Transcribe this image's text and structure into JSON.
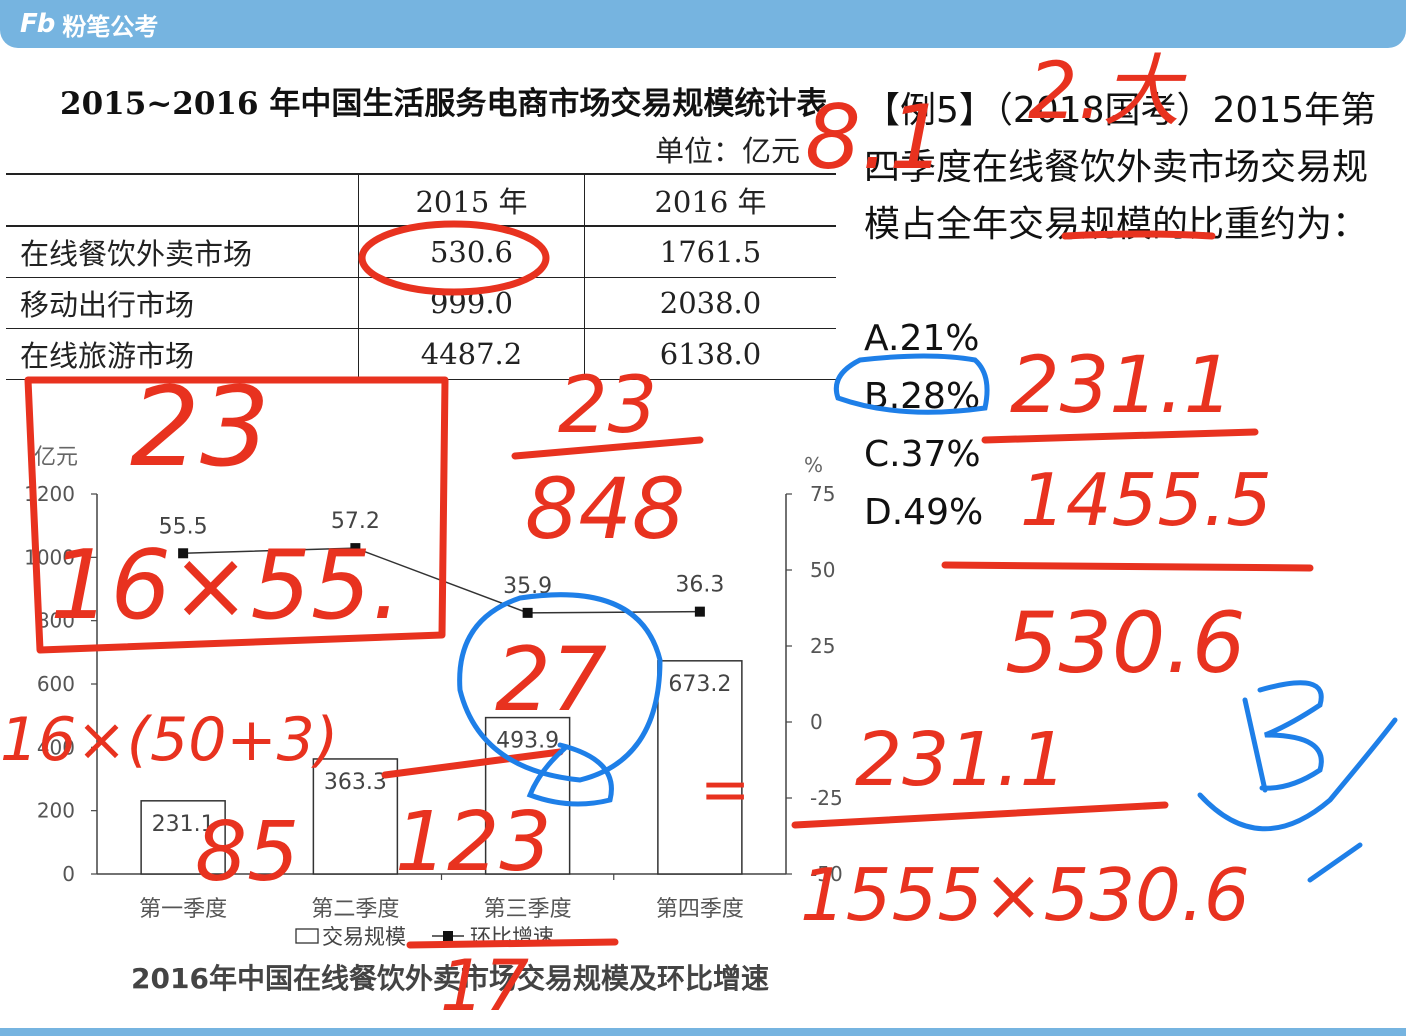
{
  "header": {
    "logo_mark": "Fb",
    "logo_text": "粉笔公考"
  },
  "table": {
    "title": "2015~2016 年中国生活服务电商市场交易规模统计表",
    "unit": "单位：亿元",
    "columns": [
      "",
      "2015 年",
      "2016 年"
    ],
    "rows": [
      [
        "在线餐饮外卖市场",
        "530.6",
        "1761.5"
      ],
      [
        "移动出行市场",
        "999.0",
        "2038.0"
      ],
      [
        "在线旅游市场",
        "4487.2",
        "6138.0"
      ]
    ]
  },
  "question": {
    "text": "【例5】（2018国考）2015年第四季度在线餐饮外卖市场交易规模占全年交易规模的比重约为：",
    "options": [
      "A.21%",
      "B.28%",
      "C.37%",
      "D.49%"
    ]
  },
  "chart_data": {
    "type": "bar",
    "title": "2016年中国在线餐饮外卖市场交易规模及环比增速",
    "categories": [
      "第一季度",
      "第二季度",
      "第三季度",
      "第四季度"
    ],
    "y_left_label": "亿元",
    "y_right_label": "%",
    "y_left_ticks": [
      "0",
      "200",
      "400",
      "600",
      "800",
      "1000",
      "1200"
    ],
    "y_right_ticks": [
      "-50",
      "-25",
      "0",
      "25",
      "50",
      "75"
    ],
    "ylim_left": [
      0,
      1200
    ],
    "ylim_right": [
      -50,
      75
    ],
    "series": [
      {
        "name": "交易规模",
        "kind": "bar",
        "values": [
          231.1,
          363.3,
          493.9,
          673.2
        ],
        "labels": [
          "231.1",
          "363.3",
          "493.9",
          "673.2"
        ]
      },
      {
        "name": "环比增速",
        "kind": "line",
        "values": [
          55.5,
          57.2,
          35.9,
          36.3
        ],
        "labels": [
          "55.5",
          "57.2",
          "35.9",
          "36.3"
        ]
      }
    ]
  },
  "annotations": {
    "red": [
      "8.1",
      "2.大",
      "23",
      "16×55.",
      "23",
      "848",
      "27",
      "231.1",
      "1455.5",
      "530.6",
      "231.1",
      "1555×530.6",
      "16×(50+3)",
      "85",
      "123",
      "17",
      "=",
      "B"
    ],
    "colors": {
      "red": "#e8321f",
      "blue": "#1e7fe8"
    }
  }
}
